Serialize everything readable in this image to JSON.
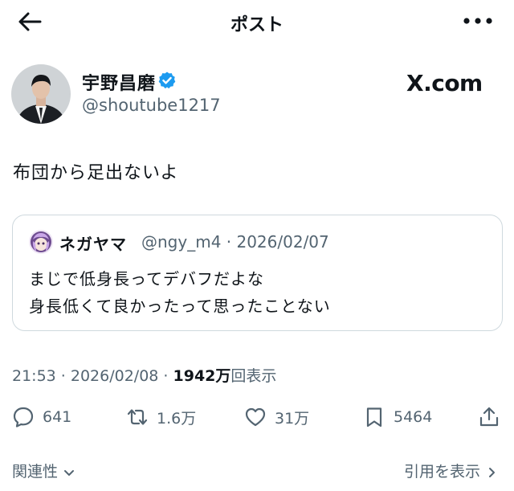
{
  "header": {
    "back_icon": "arrow-left-icon",
    "title": "ポスト",
    "more_icon": "more-horizontal-icon"
  },
  "post": {
    "author": {
      "name": "宇野昌磨",
      "handle": "@shoutube1217",
      "verified": true,
      "verified_color": "#1d9bf0"
    },
    "watermark": "X.com",
    "text": "布団から足出ないよ",
    "quoted": {
      "name": "ネガヤマ",
      "meta": "@ngy_m4 · 2026/02/07",
      "lines": [
        "まじで低身長ってデバフだよな",
        "身長低くて良かったって思ったことない"
      ]
    },
    "timestamp": "21:53 · 2026/02/08 · ",
    "views_count": "1942万",
    "views_label": "回表示",
    "actions": {
      "replies": "641",
      "reposts": "1.6万",
      "likes": "31万",
      "bookmarks": "5464"
    }
  },
  "footer": {
    "related_label": "関連性",
    "show_quotes_label": "引用を表示"
  },
  "colors": {
    "text": "#0f1419",
    "secondary": "#536471",
    "border": "#cfd9de",
    "accent": "#1d9bf0"
  }
}
